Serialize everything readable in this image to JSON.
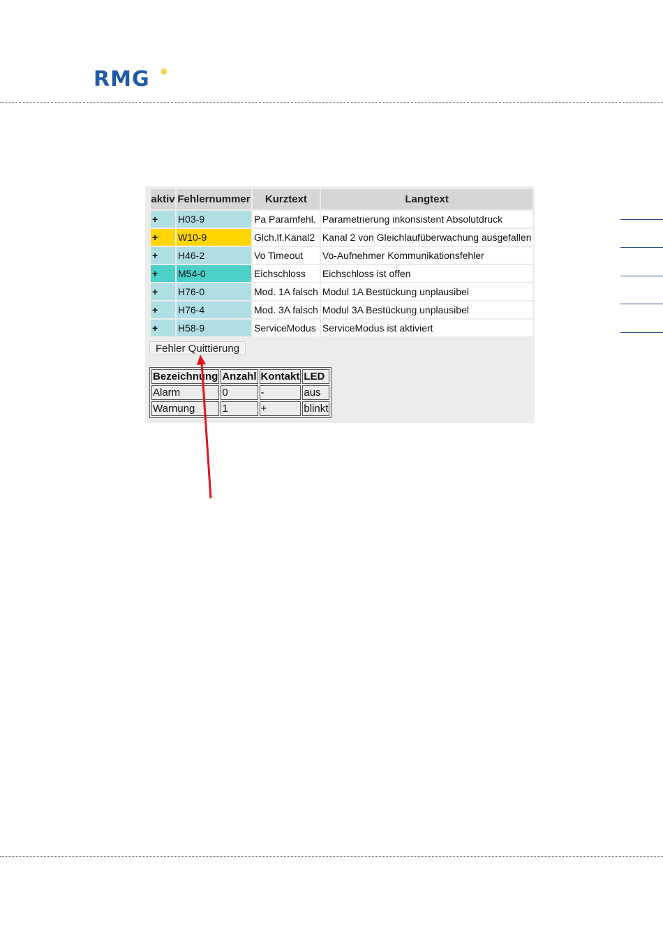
{
  "header": {
    "logo_text": "RMG"
  },
  "errors_table": {
    "columns": [
      "aktiv",
      "Fehlernummer",
      "Kurztext",
      "Langtext"
    ],
    "rows": [
      {
        "aktiv": "+",
        "nummer": "H03-9",
        "kurztext": "Pa Paramfehl.",
        "langtext": "Parametrierung inkonsistent Absolutdruck"
      },
      {
        "aktiv": "+",
        "nummer": "W10-9",
        "kurztext": "Glch.lf.Kanal2",
        "langtext": "Kanal 2 von Gleichlaufüberwachung ausgefallen"
      },
      {
        "aktiv": "+",
        "nummer": "H46-2",
        "kurztext": "Vo Timeout",
        "langtext": "Vo-Aufnehmer Kommunikationsfehler"
      },
      {
        "aktiv": "+",
        "nummer": "M54-0",
        "kurztext": "Eichschloss",
        "langtext": "Eichschloss ist offen"
      },
      {
        "aktiv": "+",
        "nummer": "H76-0",
        "kurztext": "Mod. 1A falsch",
        "langtext": "Modul 1A Bestückung unplausibel"
      },
      {
        "aktiv": "+",
        "nummer": "H76-4",
        "kurztext": "Mod. 3A falsch",
        "langtext": "Modul 3A Bestückung unplausibel"
      },
      {
        "aktiv": "+",
        "nummer": "H58-9",
        "kurztext": "ServiceModus",
        "langtext": "ServiceModus ist aktiviert"
      }
    ]
  },
  "ack_button_label": "Fehler Quittierung",
  "summary_table": {
    "columns": [
      "Bezeichnung",
      "Anzahl",
      "Kontakt",
      "LED"
    ],
    "rows": [
      {
        "bezeichnung": "Alarm",
        "anzahl": "0",
        "kontakt": "-",
        "led": "aus"
      },
      {
        "bezeichnung": "Warnung",
        "anzahl": "1",
        "kontakt": "+",
        "led": "blinkt"
      }
    ]
  },
  "colors": {
    "hint": "#b0dfe3",
    "warning": "#ffd500",
    "message": "#4cd0c8",
    "logo": "#1f5aa6",
    "arrow": "#e0161c"
  }
}
